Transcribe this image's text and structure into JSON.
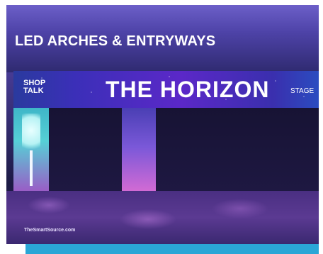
{
  "caption": "LED ARCHES & ENTRYWAYS",
  "arch": {
    "logo_line1": "SHOP",
    "logo_line2": "TALK",
    "headline": "THE HORIZON",
    "subline": "STAGE"
  },
  "watermark": "TheSmartSource.com",
  "colors": {
    "accent_bar": "#2aa6d6"
  }
}
